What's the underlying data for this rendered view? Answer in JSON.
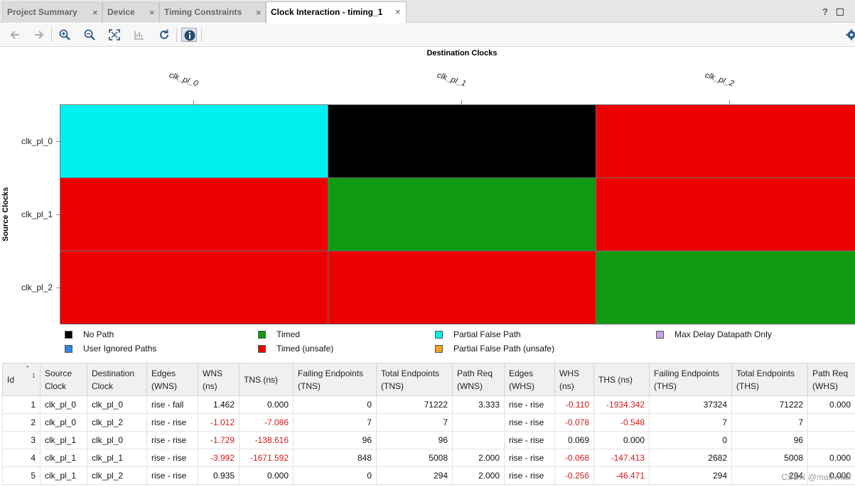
{
  "tabs": [
    {
      "label": "Project Summary",
      "active": false
    },
    {
      "label": "Device",
      "active": false
    },
    {
      "label": "Timing Constraints",
      "active": false
    },
    {
      "label": "Clock Interaction - timing_1",
      "active": true
    }
  ],
  "tab_close_glyph": "×",
  "help_glyph": "?",
  "matrix": {
    "dest_title": "Destination Clocks",
    "source_title": "Source Clocks",
    "columns": [
      "clk_pl_0",
      "clk_pl_1",
      "clk_pl_2"
    ],
    "rows": [
      "clk_pl_0",
      "clk_pl_1",
      "clk_pl_2"
    ],
    "cells": [
      [
        "Partial False Path",
        "No Path",
        "Timed (unsafe)"
      ],
      [
        "Timed (unsafe)",
        "Timed",
        "Timed (unsafe)"
      ],
      [
        "Timed (unsafe)",
        "Timed (unsafe)",
        "Timed"
      ]
    ]
  },
  "legend": [
    {
      "label": "No Path",
      "color": "#000000"
    },
    {
      "label": "Timed",
      "color": "#119a11"
    },
    {
      "label": "Partial False Path",
      "color": "#00f0f0"
    },
    {
      "label": "Max Delay Datapath Only",
      "color": "#c8a0e8"
    },
    {
      "label": "User Ignored Paths",
      "color": "#2a8ae0"
    },
    {
      "label": "Timed (unsafe)",
      "color": "#ee0000"
    },
    {
      "label": "Partial False Path (unsafe)",
      "color": "#f0a020"
    }
  ],
  "table": {
    "sort_indicator": "1",
    "columns": [
      "Id",
      "Source Clock",
      "Destination Clock",
      "Edges (WNS)",
      "WNS (ns)",
      "TNS (ns)",
      "Failing Endpoints (TNS)",
      "Total Endpoints (TNS)",
      "Path Req (WNS)",
      "Edges (WHS)",
      "WHS (ns)",
      "THS (ns)",
      "Failing Endpoints (THS)",
      "Total Endpoints (THS)",
      "Path Req (WHS)"
    ],
    "rows": [
      [
        "1",
        "clk_pl_0",
        "clk_pl_0",
        "rise - fall",
        "1.462",
        "0.000",
        "0",
        "71222",
        "3.333",
        "rise - rise",
        "-0.110",
        "-1934.342",
        "37324",
        "71222",
        "0.000"
      ],
      [
        "2",
        "clk_pl_0",
        "clk_pl_2",
        "rise - rise",
        "-1.012",
        "-7.086",
        "7",
        "7",
        "",
        "rise - rise",
        "-0.078",
        "-0.548",
        "7",
        "7",
        ""
      ],
      [
        "3",
        "clk_pl_1",
        "clk_pl_0",
        "rise - rise",
        "-1.729",
        "-138.616",
        "96",
        "96",
        "",
        "rise - rise",
        "0.069",
        "0.000",
        "0",
        "96",
        ""
      ],
      [
        "4",
        "clk_pl_1",
        "clk_pl_1",
        "rise - rise",
        "-3.992",
        "-1671.592",
        "848",
        "5008",
        "2.000",
        "rise - rise",
        "-0.068",
        "-147.413",
        "2682",
        "5008",
        "0.000"
      ],
      [
        "5",
        "clk_pl_1",
        "clk_pl_2",
        "rise - rise",
        "0.935",
        "0.000",
        "0",
        "294",
        "2.000",
        "rise - rise",
        "-0.256",
        "-46.471",
        "294",
        "294",
        "0.000"
      ]
    ]
  },
  "watermark": "CSDN @mail-mail"
}
